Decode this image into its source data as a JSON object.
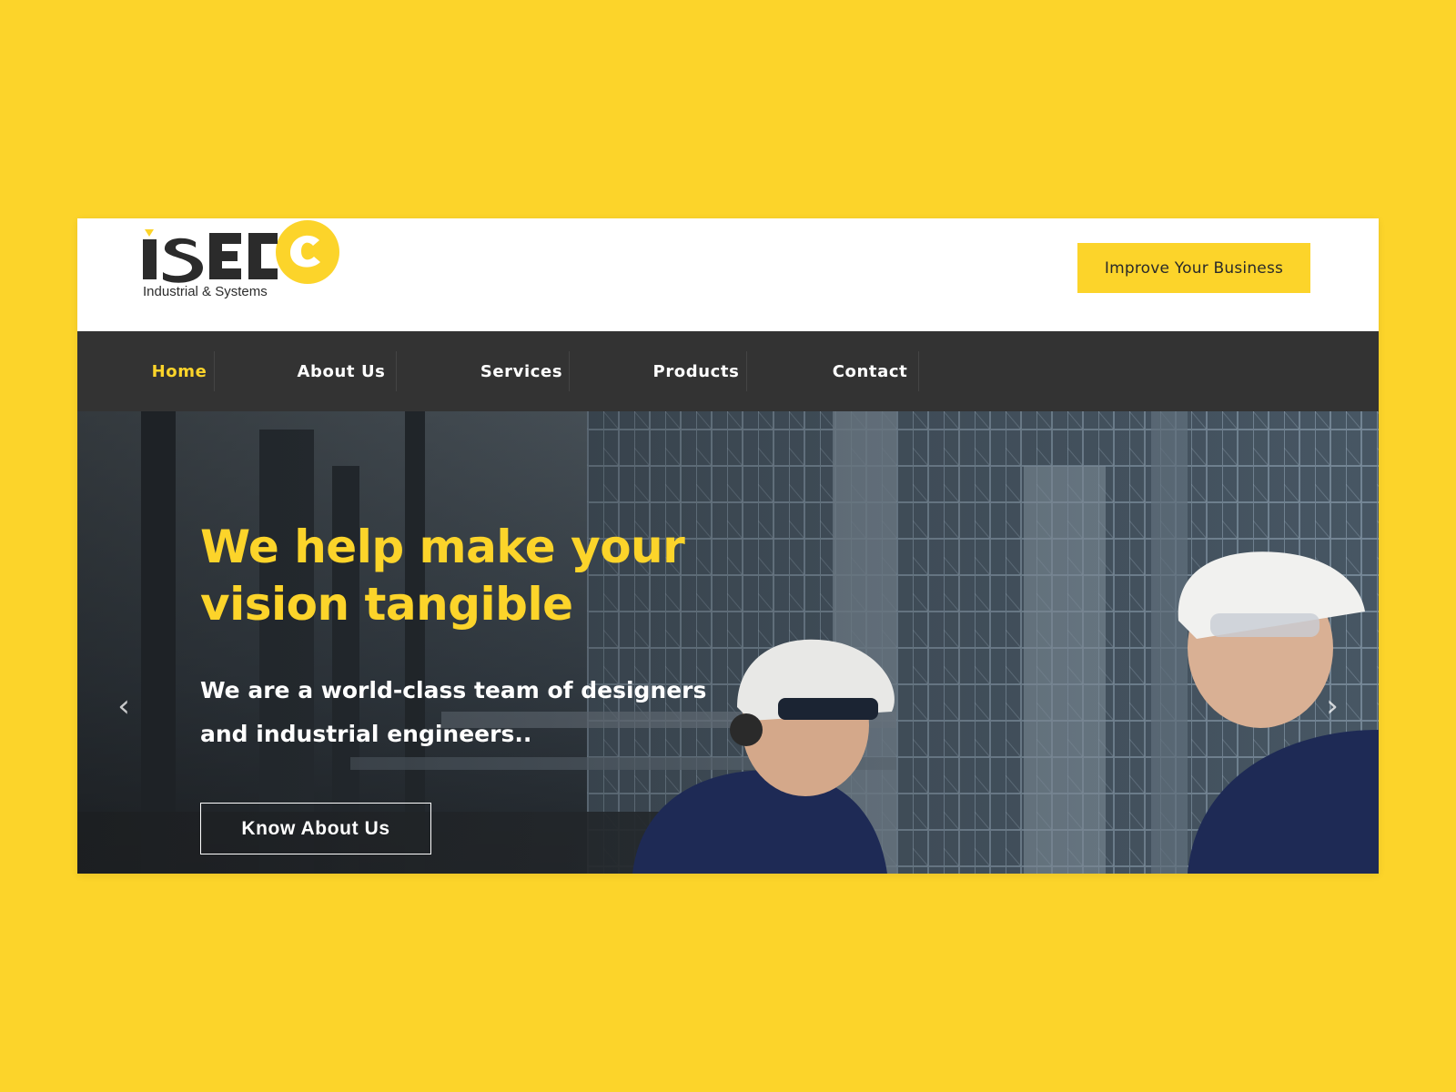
{
  "brand": {
    "logo_text": "ISEC",
    "tagline": "Industrial & Systems",
    "accent_color": "#fcd42a",
    "dark_color": "#333333"
  },
  "header": {
    "cta_label": "Improve Your Business"
  },
  "nav": {
    "items": [
      {
        "label": "Home",
        "active": true
      },
      {
        "label": "About Us",
        "active": false
      },
      {
        "label": "Services",
        "active": false
      },
      {
        "label": "Products",
        "active": false
      },
      {
        "label": "Contact",
        "active": false
      }
    ]
  },
  "hero": {
    "title_line1": "We help make your",
    "title_line2": "vision tangible",
    "subtitle_line1": "We are a world-class team of designers",
    "subtitle_line2": "and industrial engineers..",
    "button_label": "Know About Us",
    "prev_icon": "chevron-left-icon",
    "next_icon": "chevron-right-icon"
  }
}
